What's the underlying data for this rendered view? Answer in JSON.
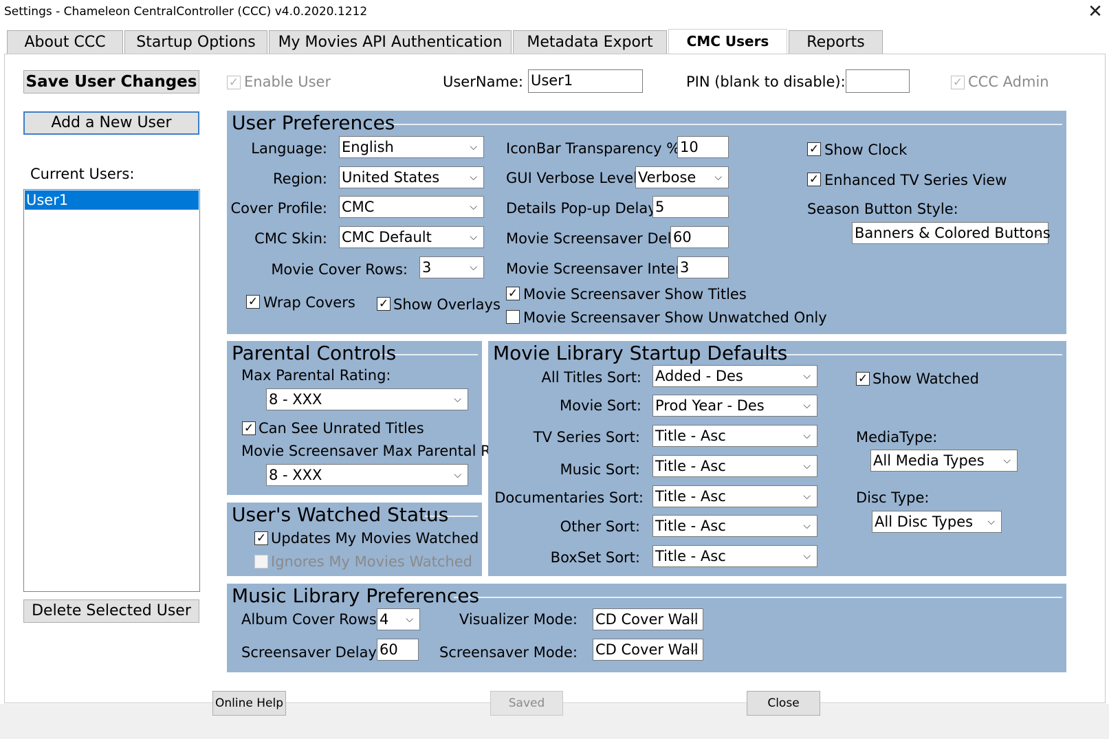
{
  "window": {
    "title": "Settings - Chameleon CentralController (CCC) v4.0.2020.1212",
    "close": "✕"
  },
  "tabs": [
    {
      "label": "About CCC"
    },
    {
      "label": "Startup Options"
    },
    {
      "label": "My Movies API Authentication"
    },
    {
      "label": "Metadata Export"
    },
    {
      "label": "CMC Users"
    },
    {
      "label": "Reports"
    }
  ],
  "active_tab": "CMC Users",
  "left": {
    "save_label": "Save User Changes",
    "add_label": "Add a New User",
    "current_users_label": "Current Users:",
    "users": [
      "User1"
    ],
    "selected_user": "User1",
    "delete_label": "Delete Selected User"
  },
  "top": {
    "enable_user_label": "Enable User",
    "enable_user_checked": true,
    "username_label": "UserName:",
    "username_value": "User1",
    "pin_label": "PIN (blank to disable):",
    "pin_value": "",
    "ccc_admin_label": "CCC Admin",
    "ccc_admin_checked": true
  },
  "user_prefs": {
    "title": "User Preferences",
    "language_label": "Language:",
    "language_value": "English",
    "region_label": "Region:",
    "region_value": "United States",
    "cover_profile_label": "Cover Profile:",
    "cover_profile_value": "CMC",
    "cmc_skin_label": "CMC Skin:",
    "cmc_skin_value": "CMC Default",
    "movie_cover_rows_label": "Movie Cover Rows:",
    "movie_cover_rows_value": "3",
    "wrap_covers_label": "Wrap Covers",
    "wrap_covers_checked": true,
    "show_overlays_label": "Show Overlays",
    "show_overlays_checked": true,
    "iconbar_label": "IconBar Transparency %:",
    "iconbar_value": "10",
    "gui_verbose_label": "GUI Verbose Level:",
    "gui_verbose_value": "Verbose",
    "details_delay_label": "Details Pop-up Delay:",
    "details_delay_value": "5",
    "ss_delay_label": "Movie Screensaver Delay:",
    "ss_delay_value": "60",
    "ss_interval_label": "Movie Screensaver Interval:",
    "ss_interval_value": "3",
    "ss_titles_label": "Movie Screensaver Show Titles",
    "ss_titles_checked": true,
    "ss_unwatched_label": "Movie Screensaver Show Unwatched Only",
    "ss_unwatched_checked": false,
    "show_clock_label": "Show Clock",
    "show_clock_checked": true,
    "enhanced_tv_label": "Enhanced TV Series View",
    "enhanced_tv_checked": true,
    "season_style_label": "Season Button Style:",
    "season_style_value": "Banners & Colored Buttons"
  },
  "parental": {
    "title": "Parental Controls",
    "max_rating_label": "Max Parental Rating:",
    "max_rating_value": "8 - XXX",
    "unrated_label": "Can See Unrated Titles",
    "unrated_checked": true,
    "ss_max_rating_label": "Movie Screensaver Max Parental Rating:",
    "ss_max_rating_value": "8 - XXX"
  },
  "watched": {
    "title": "User's Watched Status",
    "updates_label": "Updates My Movies Watched",
    "updates_checked": true,
    "ignores_label": "Ignores My Movies Watched",
    "ignores_checked": false
  },
  "movie_lib": {
    "title": "Movie Library Startup Defaults",
    "all_titles_label": "All Titles Sort:",
    "all_titles_value": "Added - Des",
    "movie_label": "Movie Sort:",
    "movie_value": "Prod Year - Des",
    "tv_label": "TV Series Sort:",
    "tv_value": "Title - Asc",
    "music_label": "Music Sort:",
    "music_value": "Title - Asc",
    "docs_label": "Documentaries Sort:",
    "docs_value": "Title - Asc",
    "other_label": "Other Sort:",
    "other_value": "Title - Asc",
    "boxset_label": "BoxSet Sort:",
    "boxset_value": "Title - Asc",
    "show_watched_label": "Show Watched",
    "show_watched_checked": true,
    "media_type_label": "MediaType:",
    "media_type_value": "All Media Types",
    "disc_type_label": "Disc Type:",
    "disc_type_value": "All Disc Types"
  },
  "music_lib": {
    "title": "Music Library Preferences",
    "album_rows_label": "Album Cover Rows:",
    "album_rows_value": "4",
    "ss_delay_label": "Screensaver Delay:",
    "ss_delay_value": "60",
    "visualizer_label": "Visualizer Mode:",
    "visualizer_value": "CD Cover Wall",
    "ss_mode_label": "Screensaver Mode:",
    "ss_mode_value": "CD Cover Wall"
  },
  "footer": {
    "help_label": "Online Help",
    "saved_label": "Saved",
    "close_label": "Close"
  },
  "icons": {
    "check": "✓",
    "chevron": "⌵"
  }
}
